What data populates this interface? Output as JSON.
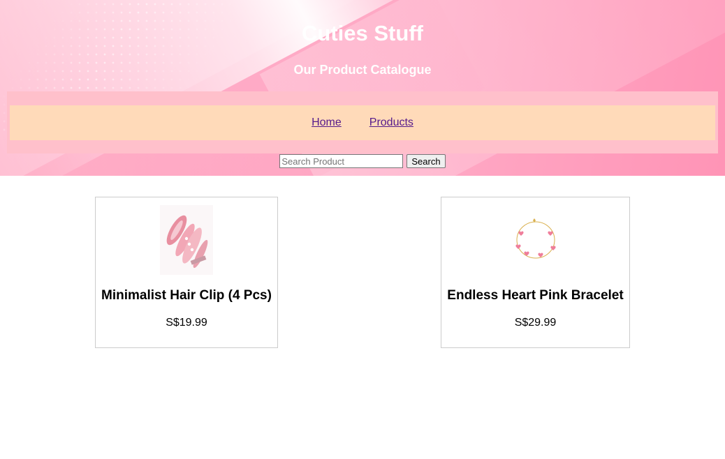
{
  "header": {
    "title": "Cuties Stuff",
    "subtitle": "Our Product Catalogue"
  },
  "nav": {
    "items": [
      {
        "label": "Home"
      },
      {
        "label": "Products"
      }
    ]
  },
  "search": {
    "placeholder": "Search Product",
    "value": "",
    "button_label": "Search"
  },
  "products": [
    {
      "name": "Minimalist Hair Clip (4 Pcs)",
      "price": "S$19.99",
      "image_icon": "hair-clip-image"
    },
    {
      "name": "Endless Heart Pink Bracelet",
      "price": "S$29.99",
      "image_icon": "bracelet-image"
    }
  ],
  "colors": {
    "nav_outer": "#ffc0cb",
    "nav_inner": "#ffdab9",
    "link": "#551a8b",
    "hero_pink": "#ffa9c5"
  }
}
